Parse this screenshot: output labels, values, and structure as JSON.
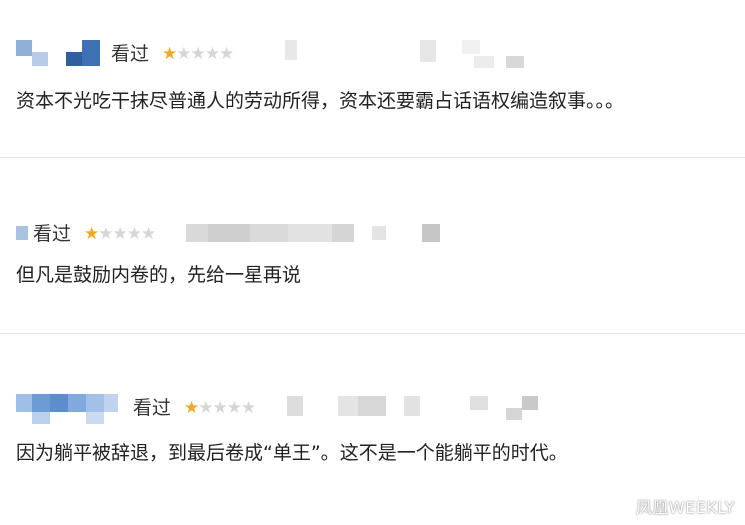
{
  "reviews": [
    {
      "status": "看过",
      "rating": 1,
      "max_rating": 5,
      "comment": "资本不光吃干抹尽普通人的劳动所得，资本还要霸占话语权编造叙事。。。"
    },
    {
      "status": "看过",
      "rating": 1,
      "max_rating": 5,
      "comment": "但凡是鼓励内卷的，先给一星再说"
    },
    {
      "status": "看过",
      "rating": 1,
      "max_rating": 5,
      "comment": "因为躺平被辞退，到最后卷成“单王”。这不是一个能躺平的时代。"
    }
  ],
  "watermark": "凤凰WEEKLY",
  "colors": {
    "star_on": "#f5a623",
    "star_off": "#d6d6d6",
    "divider": "#e3e3e3",
    "text": "#222222"
  }
}
